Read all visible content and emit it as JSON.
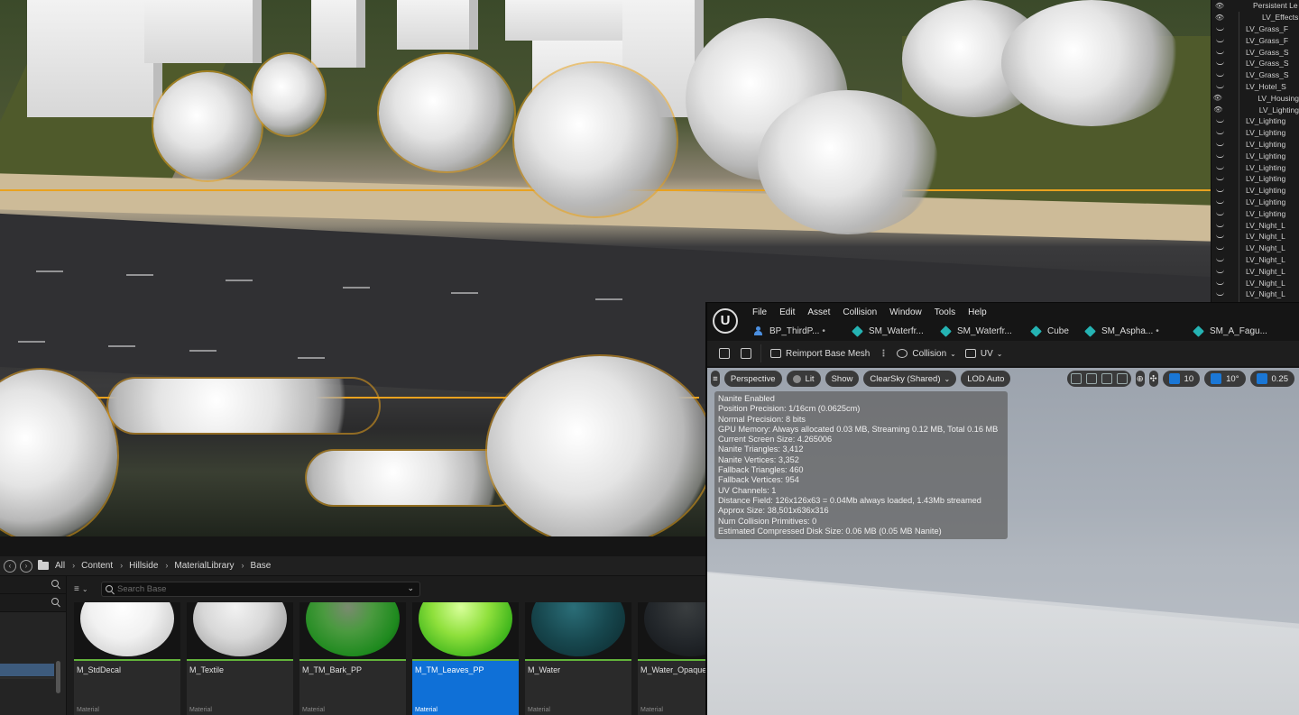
{
  "outliner": {
    "header": "Persistent Le",
    "items": [
      {
        "label": "LV_Effects",
        "visible": true
      },
      {
        "label": "LV_Grass_F",
        "visible": false
      },
      {
        "label": "LV_Grass_F",
        "visible": false
      },
      {
        "label": "LV_Grass_S",
        "visible": false
      },
      {
        "label": "LV_Grass_S",
        "visible": false
      },
      {
        "label": "LV_Grass_S",
        "visible": false
      },
      {
        "label": "LV_Hotel_S",
        "visible": false
      },
      {
        "label": "LV_Housing",
        "visible": true
      },
      {
        "label": "LV_Lighting",
        "visible": true
      },
      {
        "label": "LV_Lighting",
        "visible": false
      },
      {
        "label": "LV_Lighting",
        "visible": false
      },
      {
        "label": "LV_Lighting",
        "visible": false
      },
      {
        "label": "LV_Lighting",
        "visible": false
      },
      {
        "label": "LV_Lighting",
        "visible": false
      },
      {
        "label": "LV_Lighting",
        "visible": false
      },
      {
        "label": "LV_Lighting",
        "visible": false
      },
      {
        "label": "LV_Lighting",
        "visible": false
      },
      {
        "label": "LV_Lighting",
        "visible": false
      },
      {
        "label": "LV_Night_L",
        "visible": false
      },
      {
        "label": "LV_Night_L",
        "visible": false
      },
      {
        "label": "LV_Night_L",
        "visible": false
      },
      {
        "label": "LV_Night_L",
        "visible": false
      },
      {
        "label": "LV_Night_L",
        "visible": false
      },
      {
        "label": "LV_Night_L",
        "visible": false
      },
      {
        "label": "LV_Night_L",
        "visible": false
      },
      {
        "label": "LV_Night_L",
        "visible": false
      }
    ]
  },
  "content_browser": {
    "breadcrumb": [
      "All",
      "Content",
      "Hillside",
      "MaterialLibrary",
      "Base"
    ],
    "search_placeholder": "Search Base",
    "assets": [
      {
        "name": "M_StdDecal",
        "type": "Material",
        "thumb": "white",
        "selected": false
      },
      {
        "name": "M_Textile",
        "type": "Material",
        "thumb": "grey",
        "selected": false
      },
      {
        "name": "M_TM_Bark_PP",
        "type": "Material",
        "thumb": "green-bark",
        "selected": false
      },
      {
        "name": "M_TM_Leaves_PP",
        "type": "Material",
        "thumb": "green-leaves",
        "selected": true
      },
      {
        "name": "M_Water",
        "type": "Material",
        "thumb": "water",
        "selected": false
      },
      {
        "name": "M_Water_Opaque",
        "type": "Material",
        "thumb": "dark",
        "selected": false
      }
    ]
  },
  "mesh_editor": {
    "menu": [
      "File",
      "Edit",
      "Asset",
      "Collision",
      "Window",
      "Tools",
      "Help"
    ],
    "tabs": [
      {
        "label": "BP_ThirdP...",
        "icon": "person-icon",
        "dirty": true
      },
      {
        "label": "SM_Waterfr...",
        "icon": "static-mesh-icon",
        "dirty": false
      },
      {
        "label": "SM_Waterfr...",
        "icon": "static-mesh-icon",
        "dirty": false
      },
      {
        "label": "Cube",
        "icon": "static-mesh-icon",
        "dirty": false
      },
      {
        "label": "SM_Aspha...",
        "icon": "static-mesh-icon",
        "dirty": true
      },
      {
        "label": "SM_A_Fagu...",
        "icon": "static-mesh-icon",
        "dirty": false
      }
    ],
    "toolbar": {
      "reimport_label": "Reimport Base Mesh",
      "collision_label": "Collision",
      "uv_label": "UV"
    },
    "viewport_bar": {
      "perspective": "Perspective",
      "lit": "Lit",
      "show": "Show",
      "sky": "ClearSky (Shared)",
      "lod": "LOD Auto",
      "grid_snap": "10",
      "rot_snap": "10°",
      "scale_snap": "0.25"
    },
    "stats": [
      "Nanite Enabled",
      "Position Precision: 1/16cm (0.0625cm)",
      "Normal Precision: 8 bits",
      "GPU Memory: Always allocated 0.03 MB, Streaming 0.12 MB, Total 0.16 MB",
      "Current Screen Size: 4.265006",
      "Nanite Triangles: 3,412",
      "Nanite Vertices: 3,352",
      "Fallback Triangles: 460",
      "Fallback Vertices: 954",
      "UV Channels: 1",
      "Distance Field: 126x126x63 = 0.04Mb always loaded, 1.43Mb streamed",
      "Approx Size: 38,501x636x316",
      "Num Collision Primitives: 0",
      "Estimated Compressed Disk Size: 0.06 MB (0.05 MB Nanite)"
    ]
  }
}
